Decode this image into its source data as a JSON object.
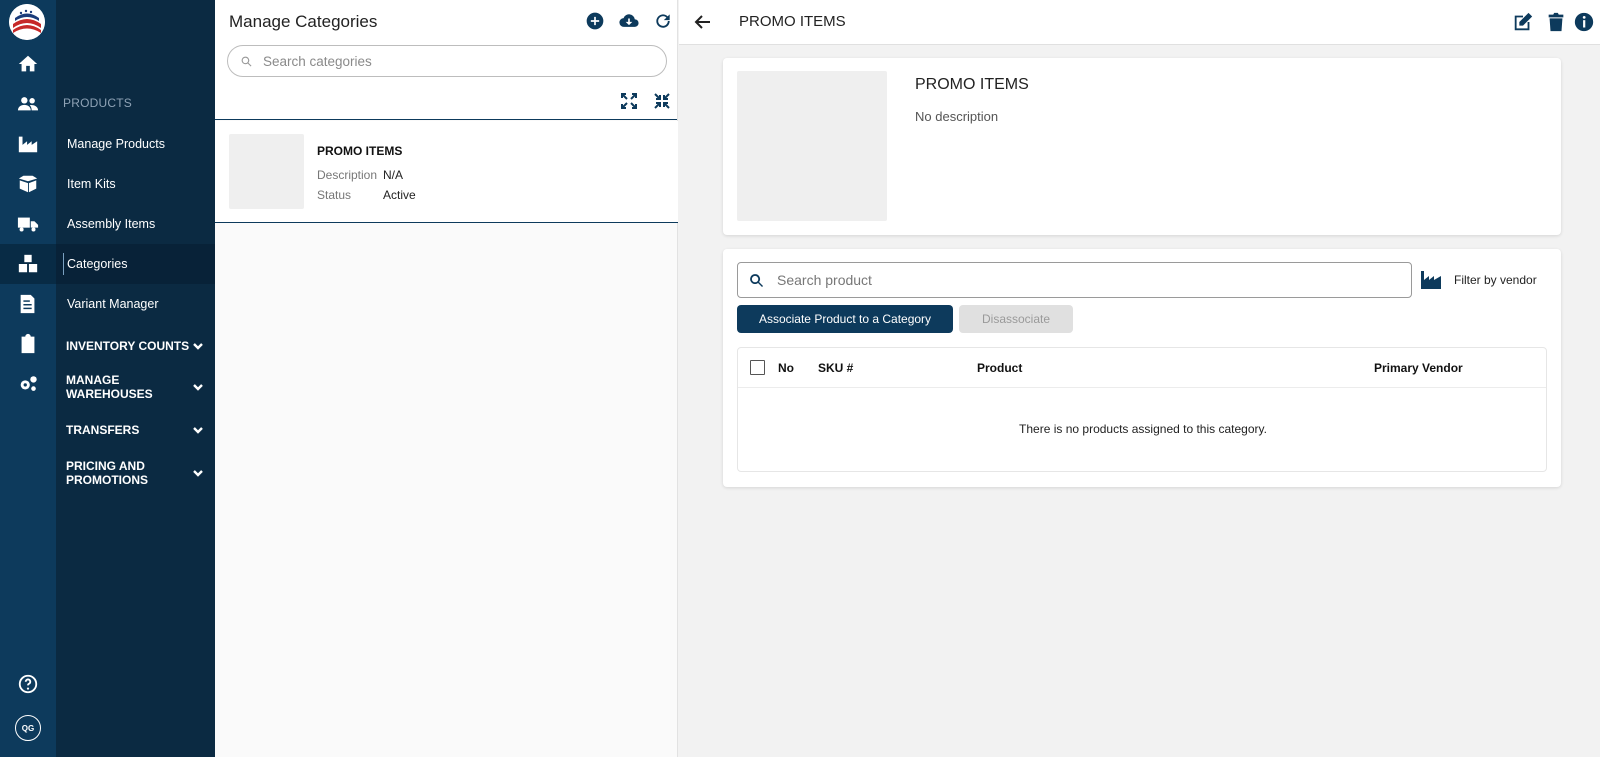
{
  "rail": {
    "icons": [
      "logo-icon",
      "home-icon",
      "users-icon",
      "factory-icon",
      "box-icon",
      "truck-icon",
      "categories-icon",
      "invoice-icon",
      "clipboard-icon",
      "gears-icon",
      "help-icon",
      "user-avatar-icon"
    ],
    "avatar_initials": "QG"
  },
  "subnav": {
    "section_label": "PRODUCTS",
    "items": [
      {
        "label": "Manage Products"
      },
      {
        "label": "Item Kits"
      },
      {
        "label": "Assembly Items"
      },
      {
        "label": "Categories",
        "active": true
      },
      {
        "label": "Variant Manager"
      }
    ],
    "groups": [
      {
        "label": "INVENTORY COUNTS"
      },
      {
        "label": "MANAGE WAREHOUSES"
      },
      {
        "label": "TRANSFERS"
      },
      {
        "label": "PRICING AND PROMOTIONS"
      }
    ]
  },
  "categories_panel": {
    "title": "Manage Categories",
    "search_placeholder": "Search categories",
    "category": {
      "name": "PROMO ITEMS",
      "description_label": "Description",
      "description_value": "N/A",
      "status_label": "Status",
      "status_value": "Active"
    }
  },
  "detail": {
    "title": "PROMO ITEMS",
    "category_name": "PROMO ITEMS",
    "description": "No description",
    "product_search_placeholder": "Search product",
    "filter_label": "Filter by vendor",
    "associate_button": "Associate Product to a Category",
    "disassociate_button": "Disassociate",
    "table": {
      "columns": [
        "No",
        "SKU #",
        "Product",
        "Primary Vendor"
      ],
      "empty_message": "There is no products assigned to this category."
    }
  },
  "colors": {
    "rail": "#0d3a5c",
    "subnav": "#0b2a42",
    "accent": "#0d3a5c",
    "page_bg": "#f2f2f2"
  }
}
